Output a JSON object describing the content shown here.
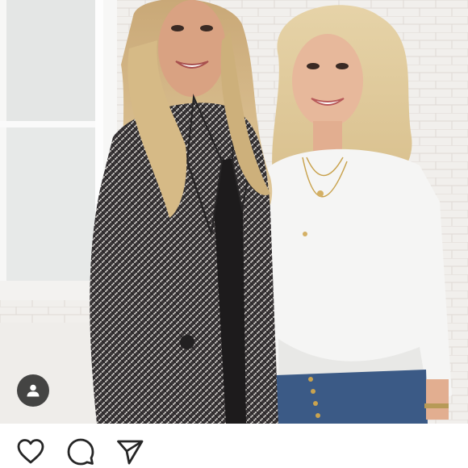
{
  "post": {
    "image": {
      "subject": "photo-two-women"
    },
    "tag_button": {
      "icon": "user-icon"
    },
    "actions": [
      {
        "icon": "heart-icon"
      },
      {
        "icon": "comment-icon"
      },
      {
        "icon": "send-icon"
      }
    ]
  },
  "colors": {
    "icon_stroke": "#262626",
    "tag_bg": "#262626",
    "background": "#ffffff"
  }
}
